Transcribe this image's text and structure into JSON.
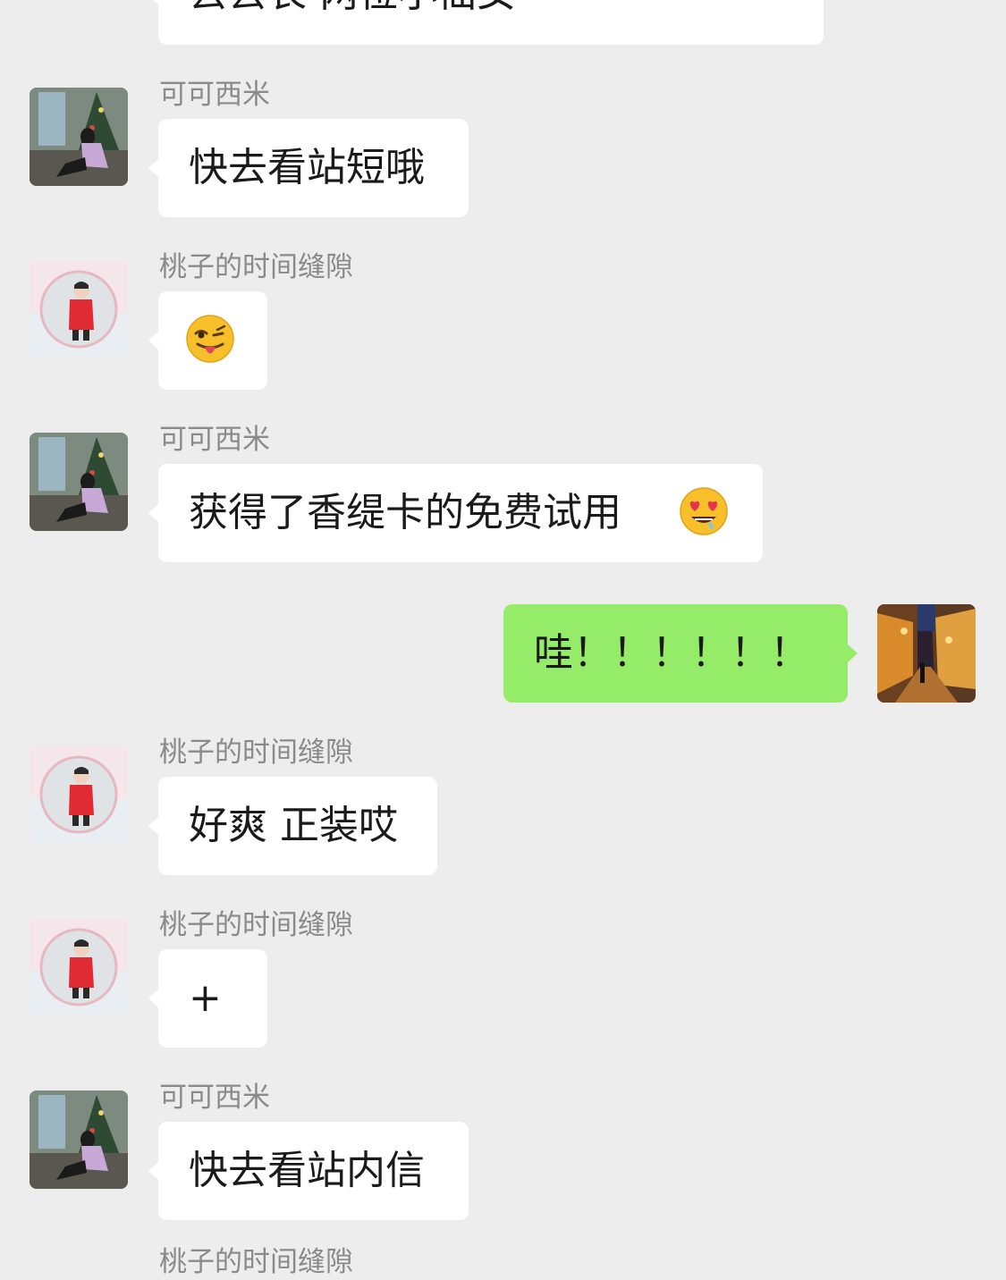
{
  "messages": [
    {
      "sender": "",
      "text": "去去长 两位小仙女",
      "direction": "in"
    },
    {
      "sender": "可可西米",
      "text": "快去看站短哦",
      "direction": "in"
    },
    {
      "sender": "桃子的时间缝隙",
      "text": "",
      "emoji": "winking-tongue-emoji",
      "direction": "in"
    },
    {
      "sender": "可可西米",
      "text": "获得了香缇卡的免费试用",
      "emoji": "heart-eyes-emoji",
      "direction": "in"
    },
    {
      "sender": "",
      "text": "哇！！！！！！",
      "direction": "out"
    },
    {
      "sender": "桃子的时间缝隙",
      "text": "好爽 正装哎",
      "direction": "in"
    },
    {
      "sender": "桃子的时间缝隙",
      "text": "+",
      "direction": "in"
    },
    {
      "sender": "可可西米",
      "text": "快去看站内信",
      "direction": "in"
    },
    {
      "sender": "桃子的时间缝隙",
      "text": "",
      "direction": "in"
    }
  ],
  "colors": {
    "background": "#ededed",
    "bubble_in": "#ffffff",
    "bubble_out": "#95ec69",
    "sender_name": "#8a8a8a"
  },
  "avatars": {
    "kekexi": "avatar-girl-sitting-christmas-tree",
    "taozi": "avatar-child-red-coat",
    "self": "avatar-night-street"
  }
}
